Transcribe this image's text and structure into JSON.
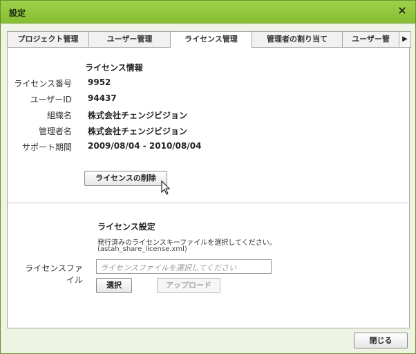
{
  "window": {
    "title": "設定"
  },
  "tabs": [
    {
      "label": "プロジェクト管理"
    },
    {
      "label": "ユーザー管理"
    },
    {
      "label": "ライセンス管理"
    },
    {
      "label": "管理者の割り当て"
    },
    {
      "label": "ユーザー管"
    }
  ],
  "license_info": {
    "heading": "ライセンス情報",
    "rows": [
      {
        "label": "ライセンス番号",
        "value": "9952"
      },
      {
        "label": "ユーザーID",
        "value": "94437"
      },
      {
        "label": "組織名",
        "value": "株式会社チェンジビジョン"
      },
      {
        "label": "管理者名",
        "value": "株式会社チェンジビジョン"
      },
      {
        "label": "サポート期間",
        "value": "2009/08/04 - 2010/08/04"
      }
    ],
    "delete_button": "ライセンスの削除"
  },
  "license_settings": {
    "heading": "ライセンス設定",
    "note_line1": "発行済みのライセンスキーファイルを選択してください。",
    "note_line2": "(astah_share_license.xml)",
    "file_label": "ライセンスファイル",
    "file_placeholder": "ライセンスファイルを選択してください",
    "select_button": "選択",
    "upload_button": "アップロード"
  },
  "footer": {
    "close_button": "閉じる"
  }
}
